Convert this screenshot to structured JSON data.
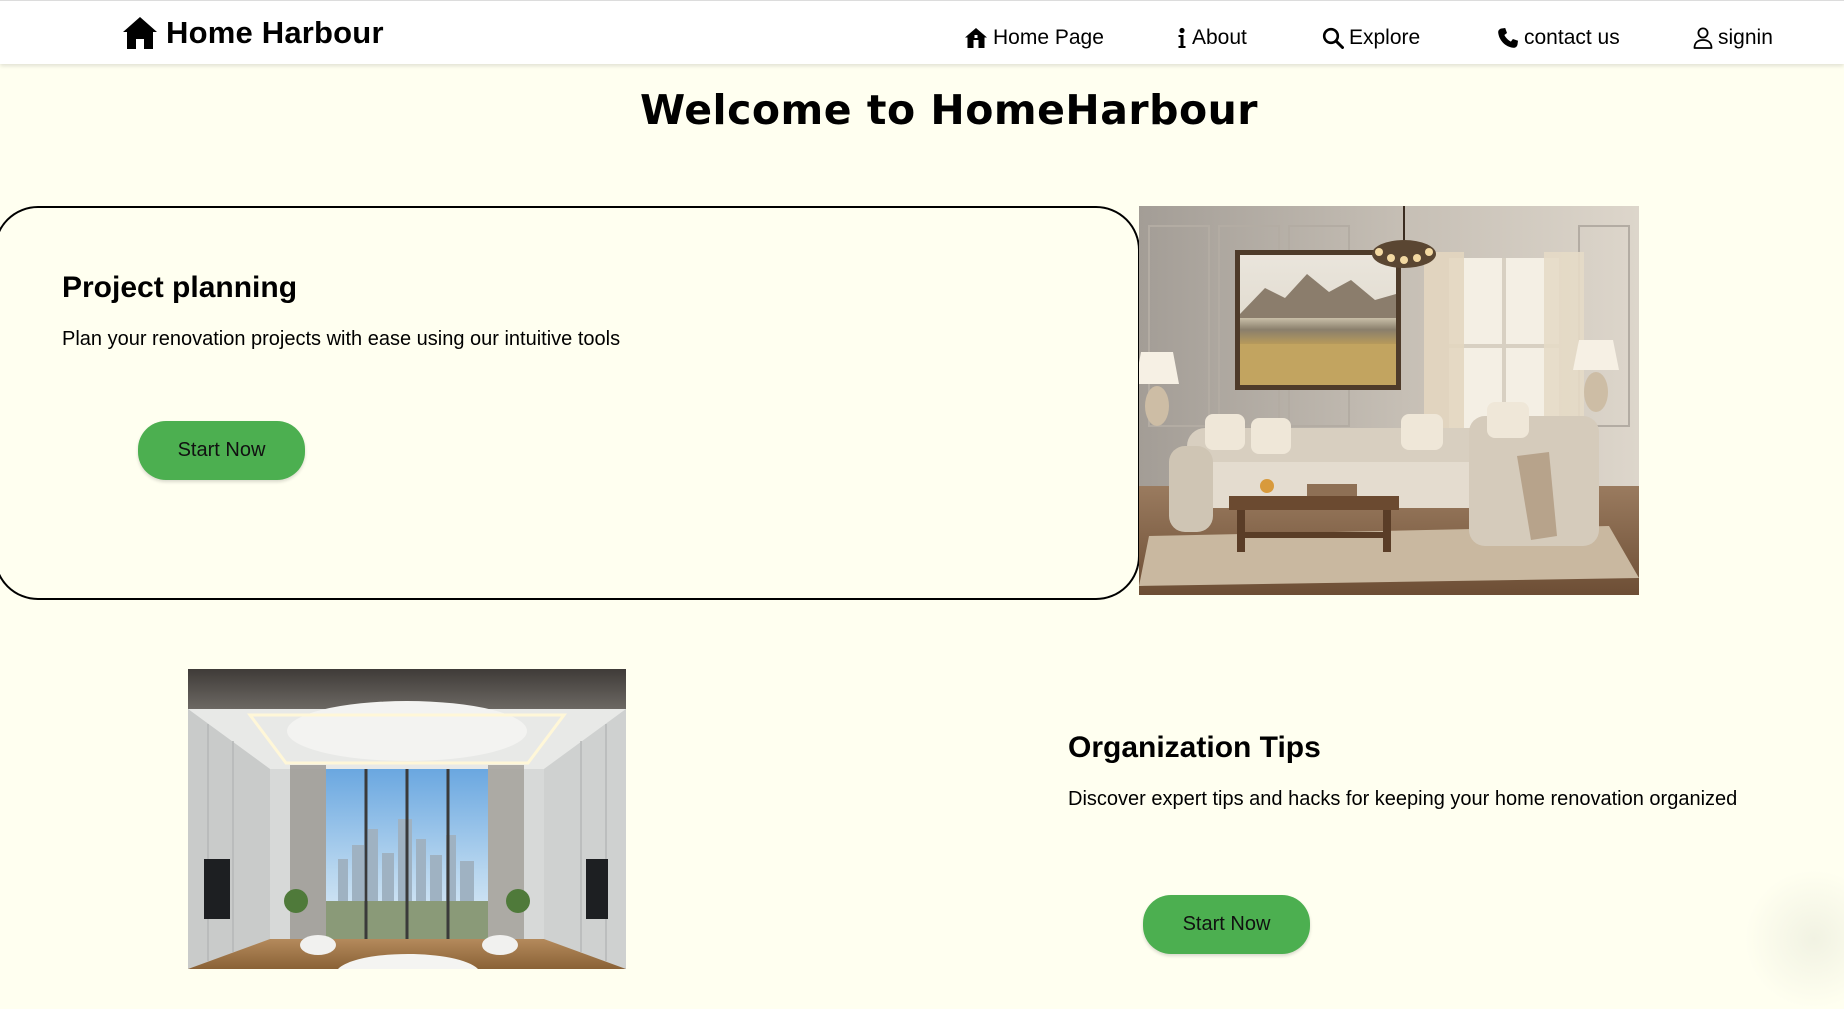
{
  "header": {
    "brand": {
      "title": "Home Harbour",
      "icon": "house-icon"
    },
    "nav": [
      {
        "label": "Home Page",
        "icon": "house-icon"
      },
      {
        "label": "About",
        "icon": "info-icon"
      },
      {
        "label": "Explore",
        "icon": "search-icon"
      },
      {
        "label": "contact us",
        "icon": "phone-icon"
      },
      {
        "label": "signin",
        "icon": "user-icon"
      }
    ]
  },
  "welcome": {
    "heading": "Welcome to HomeHarbour"
  },
  "features": [
    {
      "title": "Project planning",
      "description": "Plan your renovation projects with ease using our intuitive tools",
      "button_label": "Start Now",
      "image": "living-room-image"
    },
    {
      "title": "Organization Tips",
      "description": "Discover expert tips and hacks for keeping your home renovation organized",
      "button_label": "Start Now",
      "image": "bedroom-city-view-image"
    }
  ],
  "colors": {
    "page_background": "#fffff0",
    "header_background": "#ffffff",
    "button_green": "#4caf50",
    "text": "#000000"
  }
}
